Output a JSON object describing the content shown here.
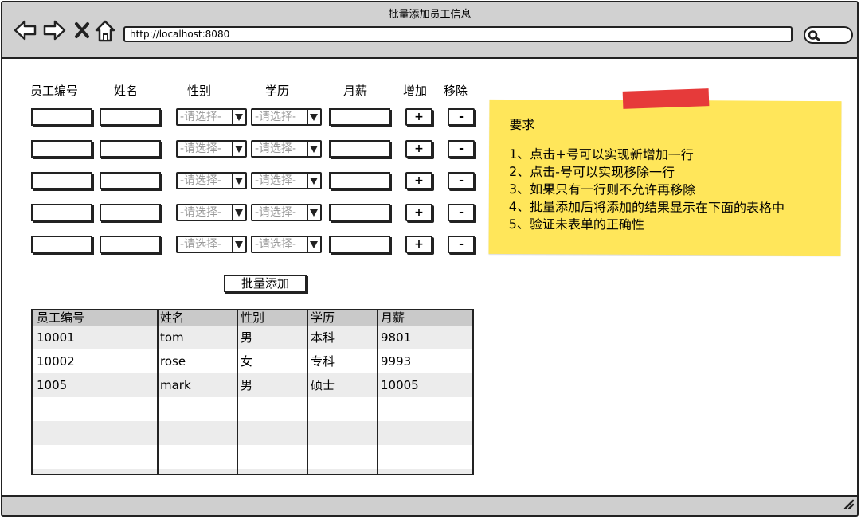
{
  "window": {
    "title": "批量添加员工信息"
  },
  "browser": {
    "url": "http://localhost:8080"
  },
  "form": {
    "headers": {
      "id": "员工编号",
      "name": "姓名",
      "gender": "性别",
      "education": "学历",
      "salary": "月薪",
      "add": "增加",
      "remove": "移除"
    },
    "select_placeholder": "-请选择-",
    "add_label": "+",
    "remove_label": "-",
    "batch_button": "批量添加"
  },
  "table": {
    "headers": [
      "员工编号",
      "姓名",
      "性别",
      "学历",
      "月薪"
    ],
    "rows": [
      [
        "10001",
        "tom",
        "男",
        "本科",
        "9801"
      ],
      [
        "10002",
        "rose",
        "女",
        "专科",
        "9993"
      ],
      [
        "1005",
        "mark",
        "男",
        "硕士",
        "10005"
      ]
    ]
  },
  "note": {
    "title": "要求",
    "items": [
      "1、点击+号可以实现新增加一行",
      "2、点击-号可以实现移除一行",
      "3、如果只有一行则不允许再移除",
      "4、批量添加后将添加的结果显示在下面的表格中",
      "5、验证未表单的正确性"
    ]
  },
  "colors": {
    "note_background": "#ffe65a",
    "tape": "#e63a3a",
    "chrome": "#d1d1d1"
  }
}
